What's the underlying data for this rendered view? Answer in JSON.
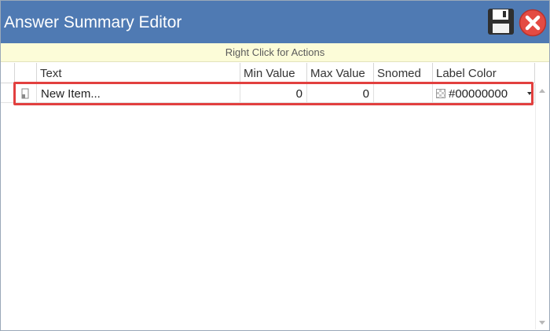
{
  "window": {
    "title": "Answer Summary Editor"
  },
  "toolbar": {
    "save_icon": "floppy-disk-icon",
    "close_icon": "close-icon"
  },
  "actions_bar": {
    "text": "Right Click for Actions"
  },
  "grid": {
    "columns": [
      "Text",
      "Min Value",
      "Max Value",
      "Snomed",
      "Label Color"
    ],
    "rows": [
      {
        "text": "New Item...",
        "min_value": "0",
        "max_value": "0",
        "snomed": "",
        "label_color": "#00000000"
      }
    ]
  },
  "colors": {
    "title_bar": "#4f7ab3",
    "actions_bar": "#fcfcd8",
    "highlight": "#e2403f",
    "close_button": "#e44b43"
  }
}
